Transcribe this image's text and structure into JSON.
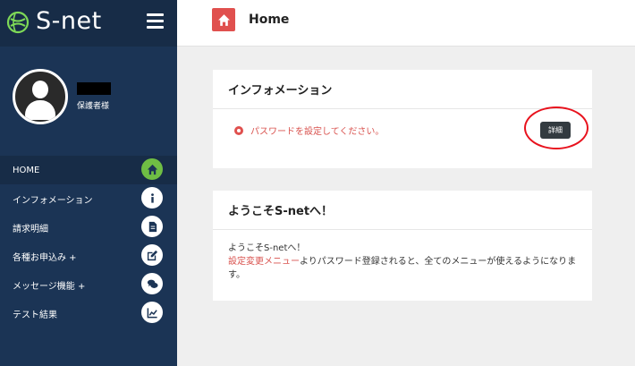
{
  "brand": {
    "name": "S-net"
  },
  "profile": {
    "role": "保護者様"
  },
  "menu": [
    {
      "label": "HOME",
      "icon": "home-icon",
      "active": true
    },
    {
      "label": "インフォメーション",
      "icon": "info-icon"
    },
    {
      "label": "請求明細",
      "icon": "file-icon"
    },
    {
      "label": "各種お申込み +",
      "icon": "edit-icon"
    },
    {
      "label": "メッセージ機能 +",
      "icon": "chat-icon"
    },
    {
      "label": "テスト結果",
      "icon": "chart-icon"
    }
  ],
  "header": {
    "title": "Home"
  },
  "info_card": {
    "title": "インフォメーション",
    "alert_text": "パスワードを設定してください。",
    "detail_label": "詳細"
  },
  "welcome_card": {
    "title": "ようこそS-netへ！",
    "line1": "ようこそS-netへ！",
    "link_text": "設定変更メニュー",
    "line2_rest": "よりパスワード登録されると、全てのメニューが使えるようになります。"
  },
  "colors": {
    "sidebar": "#1b3455",
    "accent_red": "#e0504e",
    "active_icon": "#6fbe44",
    "button": "#333b40",
    "highlight": "#e8121d"
  }
}
